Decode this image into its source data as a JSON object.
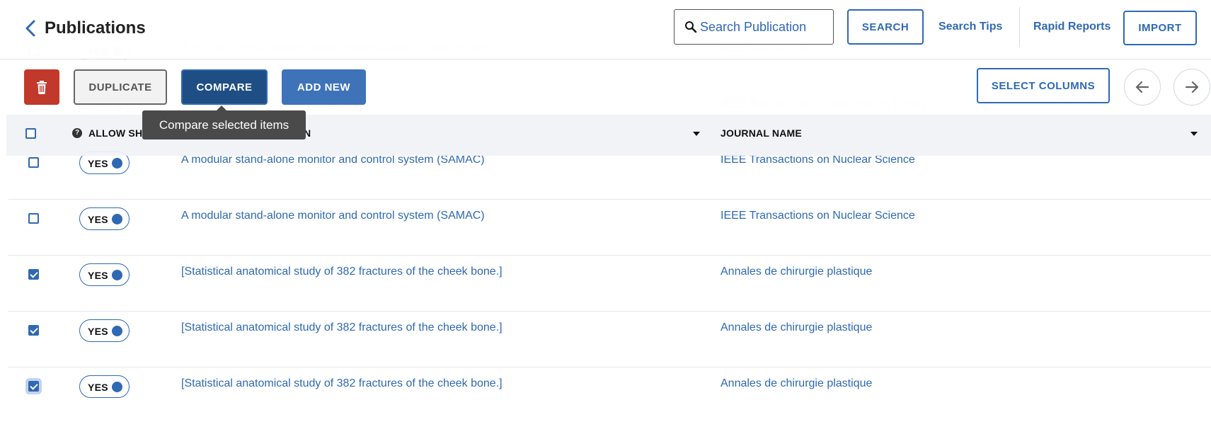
{
  "header": {
    "title": "Publications",
    "search": {
      "placeholder": "Search Publication",
      "value": ""
    },
    "search_button": "SEARCH",
    "search_tips": "Search Tips",
    "rapid_reports": "Rapid Reports",
    "import_button": "IMPORT"
  },
  "toolbar": {
    "duplicate": "DUPLICATE",
    "compare": "COMPARE",
    "add_new": "ADD NEW",
    "select_columns": "SELECT COLUMNS",
    "tooltip": "Compare selected items"
  },
  "columns": {
    "allow": "ALLOW SH",
    "title_tail": "N",
    "journal": "JOURNAL NAME"
  },
  "rows": [
    {
      "checked": false,
      "toggle": "YES",
      "title": "A microprocessor-based camac isolated digital output module",
      "journal": "IEEE Transactions on Nuclear Science",
      "faded": true
    },
    {
      "checked": false,
      "toggle": "YES",
      "title": "Optimal codes with few channels",
      "journal": "IEEE Transactions on Information Theory",
      "faded": true
    },
    {
      "checked": false,
      "toggle": "YES",
      "title": "A modular stand-alone monitor and control system (SAMAC)",
      "journal": "IEEE Transactions on Nuclear Science",
      "faded": false
    },
    {
      "checked": false,
      "toggle": "YES",
      "title": "A modular stand-alone monitor and control system (SAMAC)",
      "journal": "IEEE Transactions on Nuclear Science",
      "faded": false
    },
    {
      "checked": true,
      "toggle": "YES",
      "title": "[Statistical anatomical study of 382 fractures of the cheek bone.]",
      "journal": "Annales de chirurgie plastique",
      "faded": false
    },
    {
      "checked": true,
      "toggle": "YES",
      "title": "[Statistical anatomical study of 382 fractures of the cheek bone.]",
      "journal": "Annales de chirurgie plastique",
      "faded": false
    },
    {
      "checked": true,
      "toggle": "YES",
      "title": "[Statistical anatomical study of 382 fractures of the cheek bone.]",
      "journal": "Annales de chirurgie plastique",
      "faded": false,
      "focused": true
    }
  ],
  "colors": {
    "primary": "#2f69b3",
    "primary_dark": "#1f4e84",
    "danger": "#c0392b",
    "tooltip_bg": "#4a4a4a"
  },
  "icons": [
    "chevron-left-icon",
    "search-icon",
    "trash-icon",
    "arrow-left-icon",
    "arrow-right-icon",
    "help-icon",
    "sort-caret-icon",
    "checkbox-icon"
  ]
}
